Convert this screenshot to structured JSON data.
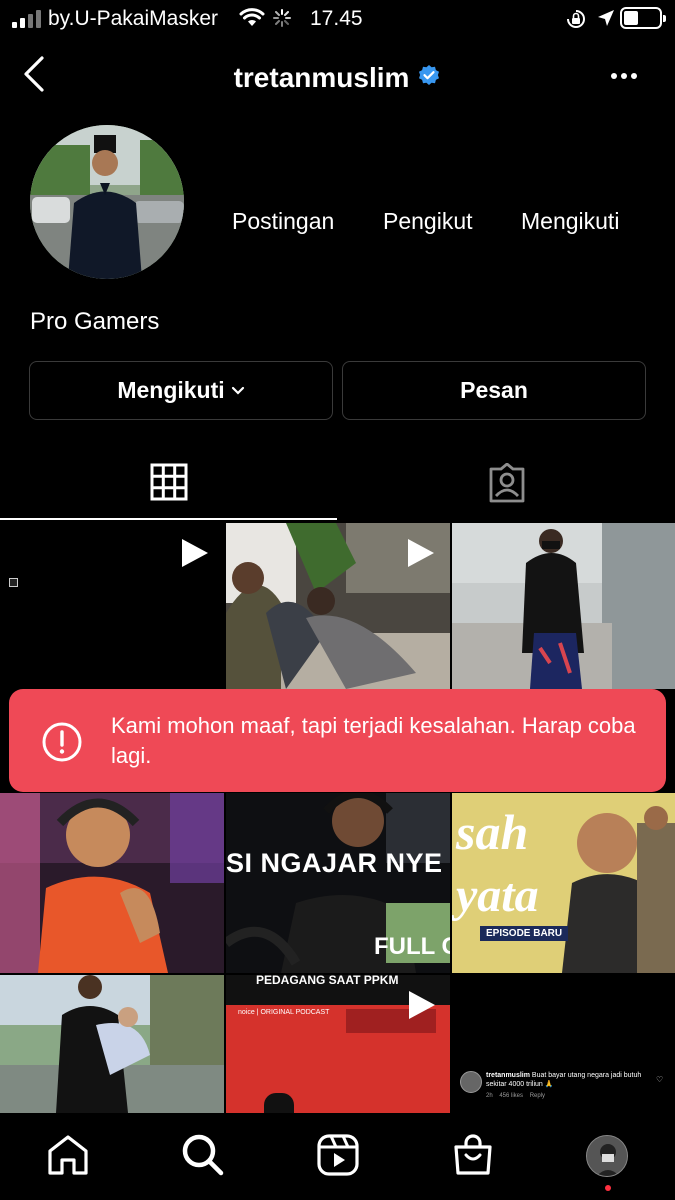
{
  "status_bar": {
    "carrier": "by.U-PakaiMasker",
    "time": "17.45"
  },
  "header": {
    "username": "tretanmuslim",
    "verified": true
  },
  "profile": {
    "stats": [
      {
        "label": "Postingan"
      },
      {
        "label": "Pengikut"
      },
      {
        "label": "Mengikuti"
      }
    ],
    "name": "Pro Gamers"
  },
  "actions": {
    "following_label": "Mengikuti",
    "message_label": "Pesan"
  },
  "tabs": [
    {
      "name": "posts-grid",
      "icon": "grid-icon",
      "active": true
    },
    {
      "name": "tagged",
      "icon": "tagged-person-icon",
      "active": false
    }
  ],
  "grid": {
    "posts": [
      {
        "type": "reel"
      },
      {
        "type": "reel"
      },
      {
        "type": "photo"
      },
      {
        "type": "photo"
      },
      {
        "type": "reel",
        "caption": "SI NGAJAR NYE",
        "caption2": "FULL GE"
      },
      {
        "type": "photo",
        "caption": "sah",
        "caption2": "yata",
        "badge": "EPISODE BARU"
      },
      {
        "type": "photo"
      },
      {
        "type": "reel",
        "caption": "PEDAGANG SAAT PPKM",
        "brand": "noice | ORIGINAL PODCAST"
      },
      {
        "type": "photo",
        "tweet_user": "tretanmuslim",
        "tweet_text": "Buat bayar utang negara jadi butuh sekitar 4000 triliun 🙏",
        "tweet_meta": "2h    456 likes    Reply"
      }
    ]
  },
  "toast": {
    "message": "Kami mohon maaf, tapi terjadi kesalahan. Harap coba lagi."
  },
  "colors": {
    "error": "#ef4956",
    "verified": "#3897f0",
    "notification_dot": "#ff3040"
  }
}
